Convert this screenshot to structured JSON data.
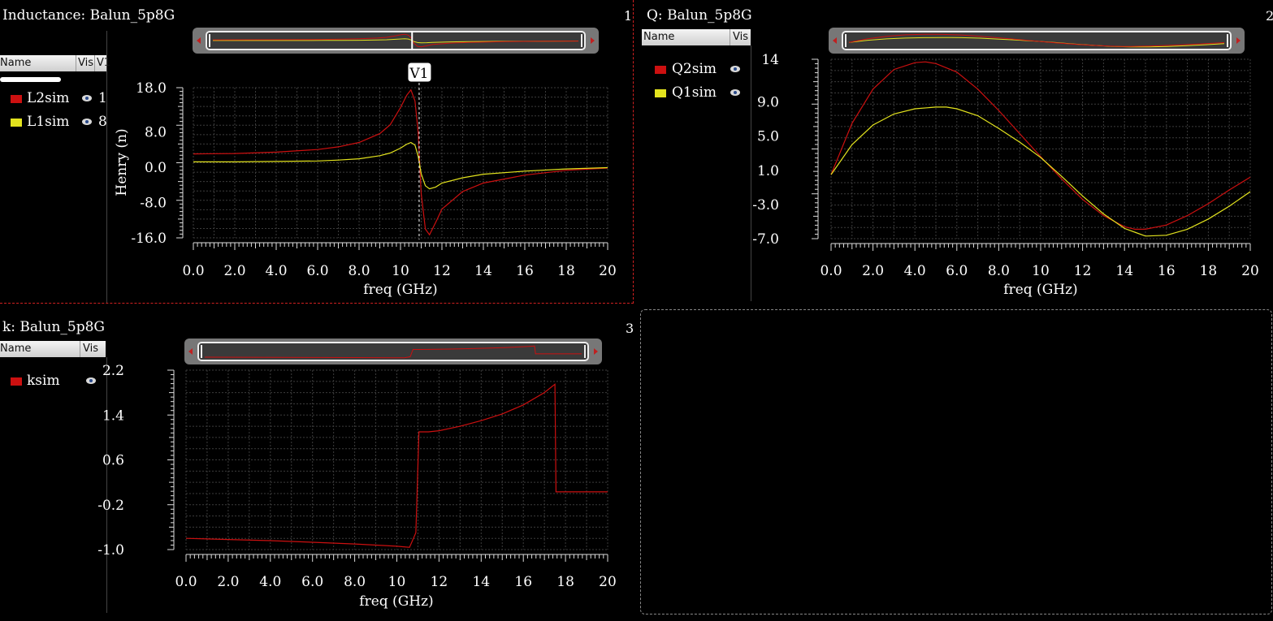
{
  "colors": {
    "red": "#cc1010",
    "yellow": "#e3e31e",
    "grid": "#3c3c3c"
  },
  "legend_header": {
    "name": "Name",
    "vis": "Vis",
    "v1": "V1"
  },
  "panels": [
    {
      "title": "Inductance: Balun_5p8G",
      "number": "1",
      "legend": [
        {
          "label": "L2sim",
          "color": "#cc1010",
          "value": "1"
        },
        {
          "label": "L1sim",
          "color": "#e3e31e",
          "value": "8"
        }
      ],
      "marker_label": "V1"
    },
    {
      "title": "Q: Balun_5p8G",
      "number": "2",
      "legend": [
        {
          "label": "Q2sim",
          "color": "#cc1010"
        },
        {
          "label": "Q1sim",
          "color": "#e3e31e"
        }
      ]
    },
    {
      "title": "k: Balun_5p8G",
      "number": "3",
      "legend": [
        {
          "label": "ksim",
          "color": "#cc1010"
        }
      ]
    }
  ],
  "chart_data": [
    {
      "type": "line",
      "title": "Inductance: Balun_5p8G",
      "xlabel": "freq (GHz)",
      "ylabel": "Henry (n)",
      "xlim": [
        0,
        20
      ],
      "ylim": [
        -16,
        18
      ],
      "xticks": [
        "0.0",
        "2.0",
        "4.0",
        "6.0",
        "8.0",
        "10",
        "12",
        "14",
        "16",
        "18",
        "20"
      ],
      "yticks": [
        "18.0",
        "8.0",
        "0.0",
        "-8.0",
        "-16.0"
      ],
      "ytick_values": [
        18,
        8,
        0,
        -8,
        -16
      ],
      "marker": {
        "label": "V1",
        "x": 10.9
      },
      "grid": true,
      "series": [
        {
          "name": "L2sim",
          "color": "#cc1010",
          "x": [
            0,
            2,
            4,
            6,
            7,
            8,
            9,
            9.5,
            10,
            10.3,
            10.5,
            10.7,
            10.85,
            11,
            11.2,
            11.4,
            11.7,
            12,
            13,
            14,
            16,
            18,
            20
          ],
          "y": [
            3,
            3.1,
            3.4,
            4,
            4.6,
            5.6,
            7.6,
            9.6,
            13.5,
            16.3,
            17.5,
            15,
            8,
            -6,
            -14,
            -15.3,
            -12.5,
            -9.5,
            -5.5,
            -3.6,
            -1.8,
            -0.7,
            -0.2
          ]
        },
        {
          "name": "L1sim",
          "color": "#e3e31e",
          "x": [
            0,
            2,
            4,
            6,
            7,
            8,
            9,
            9.5,
            10,
            10.3,
            10.5,
            10.7,
            10.85,
            11,
            11.2,
            11.4,
            11.7,
            12,
            13,
            14,
            16,
            18,
            20
          ],
          "y": [
            1.2,
            1.2,
            1.3,
            1.4,
            1.6,
            1.9,
            2.6,
            3.2,
            4.3,
            5.2,
            5.6,
            5,
            2.5,
            -1.5,
            -4.2,
            -4.9,
            -4.5,
            -3.6,
            -2.4,
            -1.6,
            -0.9,
            -0.4,
            -0.1
          ]
        }
      ]
    },
    {
      "type": "line",
      "title": "Q: Balun_5p8G",
      "xlabel": "freq (GHz)",
      "ylabel": "",
      "xlim": [
        0,
        20
      ],
      "ylim": [
        -7,
        14
      ],
      "xticks": [
        "0.0",
        "2.0",
        "4.0",
        "6.0",
        "8.0",
        "10",
        "12",
        "14",
        "16",
        "18",
        "20"
      ],
      "yticks": [
        "14",
        "9.0",
        "5.0",
        "1.0",
        "-3.0",
        "-7.0"
      ],
      "ytick_values": [
        14,
        9,
        5,
        1,
        -3,
        -7
      ],
      "grid": true,
      "series": [
        {
          "name": "Q2sim",
          "color": "#cc1010",
          "x": [
            0,
            1,
            2,
            3,
            4,
            4.5,
            5,
            6,
            7,
            8,
            9,
            10,
            11,
            12,
            13,
            14,
            14.5,
            15,
            16,
            17,
            18,
            19,
            20
          ],
          "y": [
            0.5,
            6.5,
            10.5,
            12.8,
            13.6,
            13.7,
            13.5,
            12.5,
            10.5,
            8,
            5.3,
            2.6,
            0,
            -2.4,
            -4.3,
            -5.6,
            -5.9,
            -5.9,
            -5.4,
            -4.3,
            -2.9,
            -1.3,
            0.2
          ]
        },
        {
          "name": "Q1sim",
          "color": "#e3e31e",
          "x": [
            0,
            1,
            2,
            3,
            4,
            5,
            5.5,
            6,
            7,
            8,
            9,
            10,
            11,
            12,
            13,
            14,
            15,
            16,
            17,
            18,
            19,
            20
          ],
          "y": [
            0.5,
            4,
            6.3,
            7.6,
            8.2,
            8.4,
            8.4,
            8.2,
            7.4,
            5.9,
            4.3,
            2.5,
            0.3,
            -2,
            -4.1,
            -5.8,
            -6.7,
            -6.6,
            -5.9,
            -4.7,
            -3.2,
            -1.5
          ]
        }
      ]
    },
    {
      "type": "line",
      "title": "k: Balun_5p8G",
      "xlabel": "freq (GHz)",
      "ylabel": "",
      "xlim": [
        0,
        20
      ],
      "ylim": [
        -1.0,
        2.2
      ],
      "xticks": [
        "0.0",
        "2.0",
        "4.0",
        "6.0",
        "8.0",
        "10",
        "12",
        "14",
        "16",
        "18",
        "20"
      ],
      "yticks": [
        "2.2",
        "1.4",
        "0.6",
        "-0.2",
        "-1.0"
      ],
      "ytick_values": [
        2.2,
        1.4,
        0.6,
        -0.2,
        -1.0
      ],
      "grid": true,
      "series": [
        {
          "name": "ksim",
          "color": "#cc1010",
          "x": [
            0,
            2,
            4,
            6,
            8,
            9,
            10,
            10.6,
            10.9,
            11.05,
            11.5,
            12,
            13,
            14,
            15,
            16,
            17,
            17.5,
            17.55,
            18,
            20
          ],
          "y": [
            -0.8,
            -0.82,
            -0.84,
            -0.87,
            -0.9,
            -0.92,
            -0.94,
            -0.96,
            -0.7,
            1.1,
            1.1,
            1.12,
            1.2,
            1.3,
            1.42,
            1.58,
            1.8,
            1.95,
            0.03,
            0.03,
            0.03
          ]
        }
      ]
    }
  ]
}
